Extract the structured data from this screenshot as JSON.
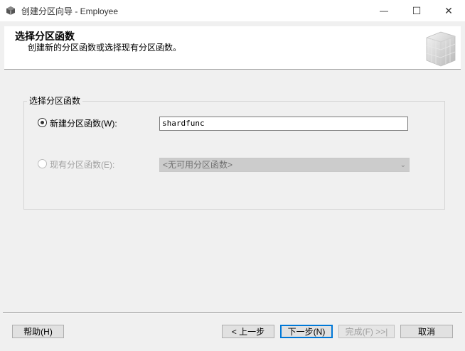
{
  "window": {
    "title": "创建分区向导 - Employee",
    "minimize_glyph": "—",
    "maximize_glyph": "☐",
    "close_glyph": "✕"
  },
  "header": {
    "title": "选择分区函数",
    "subtitle": "创建新的分区函数或选择现有分区函数。",
    "icon": "cube-grid-icon"
  },
  "group": {
    "label": "选择分区函数",
    "new_option": {
      "label": "新建分区函数(W):",
      "selected": true,
      "value": "shardfunc"
    },
    "existing_option": {
      "label": "现有分区函数(E):",
      "selected": false,
      "enabled": false,
      "combo_value": "<无可用分区函数>"
    }
  },
  "buttons": {
    "help": "帮助(H)",
    "back": "< 上一步",
    "next": "下一步(N)",
    "finish": "完成(F) >>|",
    "cancel": "取消"
  },
  "colors": {
    "accent": "#0078d7",
    "window_bg": "#f0f0f0",
    "header_bg": "#ffffff"
  }
}
